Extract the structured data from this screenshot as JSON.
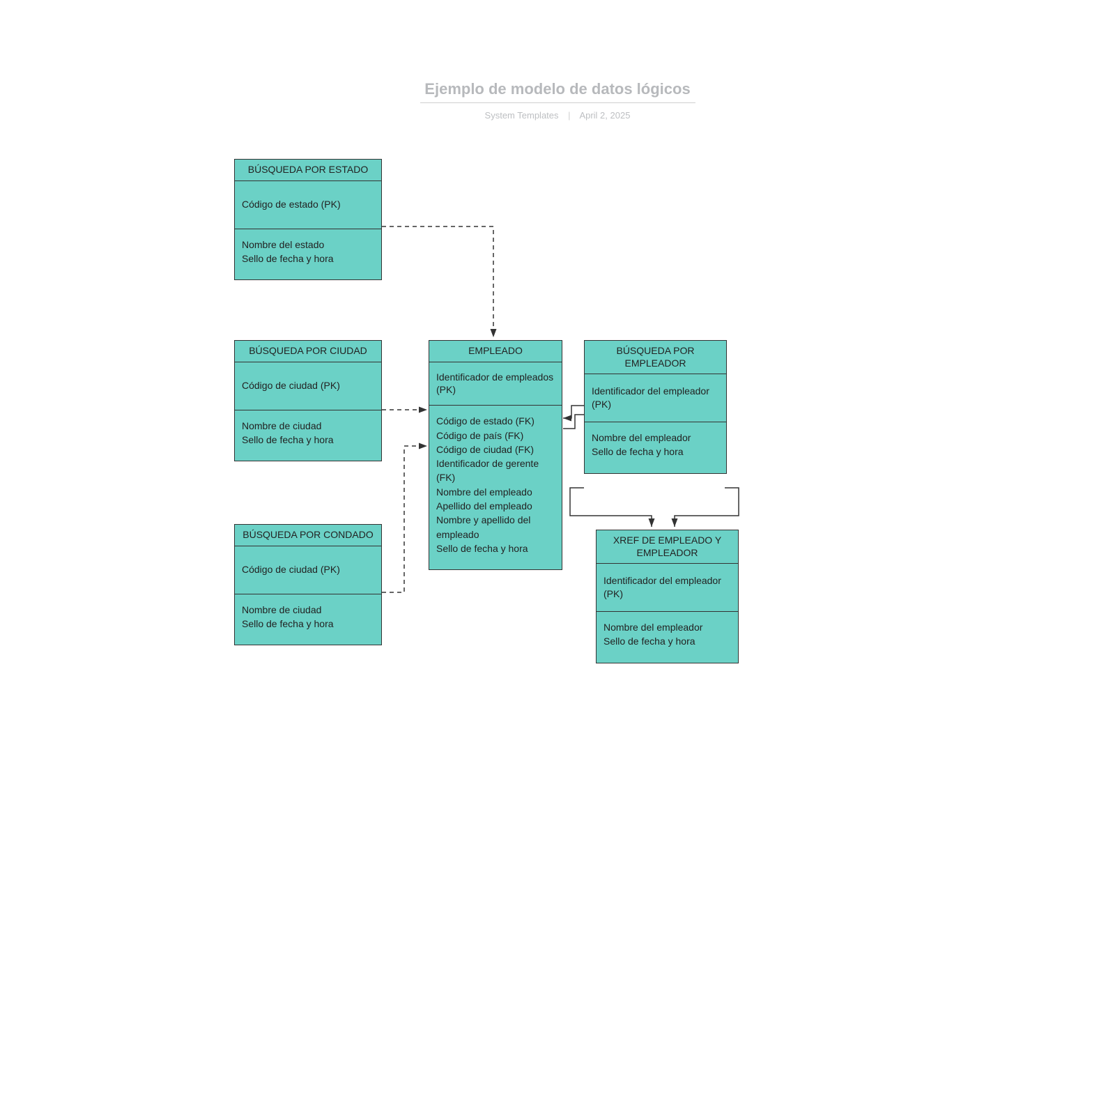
{
  "header": {
    "title": "Ejemplo de modelo de datos lógicos",
    "template_source": "System Templates",
    "date": "April 2, 2025"
  },
  "entities": {
    "estado": {
      "title": "BÚSQUEDA POR ESTADO",
      "pk": "Código de estado (PK)",
      "attrs": "Nombre del estado\nSello de fecha y hora"
    },
    "ciudad": {
      "title": "BÚSQUEDA POR CIUDAD",
      "pk": "Código de ciudad (PK)",
      "attrs": "Nombre de ciudad\nSello de fecha y hora"
    },
    "condado": {
      "title": "BÚSQUEDA POR CONDADO",
      "pk": "Código de ciudad (PK)",
      "attrs": "Nombre de ciudad\nSello de fecha y hora"
    },
    "empleado": {
      "title": "EMPLEADO",
      "pk": "Identificador de empleados (PK)",
      "attrs": "Código de estado (FK)\nCódigo de país (FK)\nCódigo de ciudad (FK)\nIdentificador de gerente (FK)\nNombre del empleado\nApellido del empleado\nNombre y apellido del empleado\nSello de fecha y hora"
    },
    "empleador": {
      "title": "BÚSQUEDA POR EMPLEADOR",
      "pk": "Identificador del empleador (PK)",
      "attrs": "Nombre del empleador\nSello de fecha y hora"
    },
    "xref": {
      "title": "XREF DE EMPLEADO Y EMPLEADOR",
      "pk": "Identificador del empleador (PK)",
      "attrs": "Nombre del empleador\nSello de fecha y hora"
    }
  },
  "colors": {
    "entity_fill": "#6bd1c6",
    "entity_border": "#333333"
  }
}
